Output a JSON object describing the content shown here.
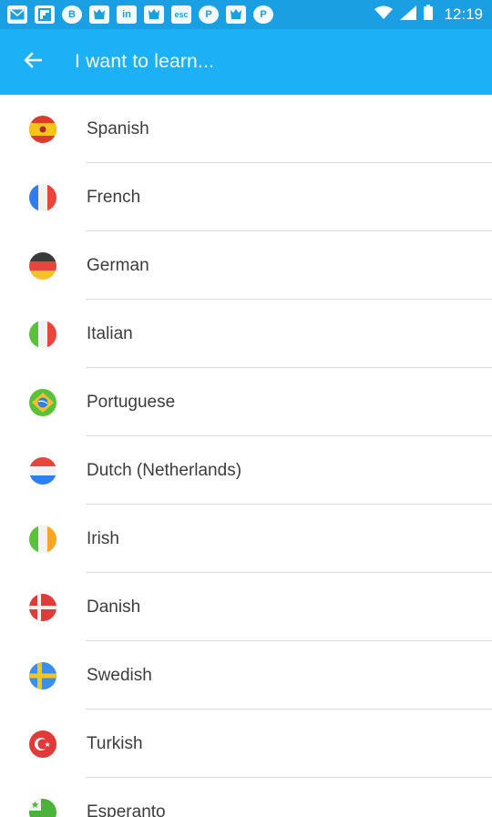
{
  "status_bar": {
    "time": "12:19",
    "left_icons": [
      "mail-icon",
      "flipboard-icon",
      "bitcoin-icon",
      "game-icon",
      "linkedin-icon",
      "game-icon",
      "esc-icon",
      "pinterest-icon",
      "game-icon",
      "pinterest-icon"
    ],
    "right_icons": [
      "wifi-icon",
      "signal-icon",
      "battery-icon"
    ]
  },
  "header": {
    "title": "I want to learn..."
  },
  "languages": [
    {
      "name": "Spanish",
      "flag": "spain-flag-icon"
    },
    {
      "name": "French",
      "flag": "france-flag-icon"
    },
    {
      "name": "German",
      "flag": "germany-flag-icon"
    },
    {
      "name": "Italian",
      "flag": "italy-flag-icon"
    },
    {
      "name": "Portuguese",
      "flag": "brazil-flag-icon"
    },
    {
      "name": "Dutch (Netherlands)",
      "flag": "netherlands-flag-icon"
    },
    {
      "name": "Irish",
      "flag": "ireland-flag-icon"
    },
    {
      "name": "Danish",
      "flag": "denmark-flag-icon"
    },
    {
      "name": "Swedish",
      "flag": "sweden-flag-icon"
    },
    {
      "name": "Turkish",
      "flag": "turkey-flag-icon"
    },
    {
      "name": "Esperanto",
      "flag": "esperanto-flag-icon"
    }
  ],
  "colors": {
    "status_bar": "#1a9fe3",
    "app_bar": "#1cb0f6",
    "text": "#3c3c3c",
    "divider": "#d9d9d9"
  }
}
